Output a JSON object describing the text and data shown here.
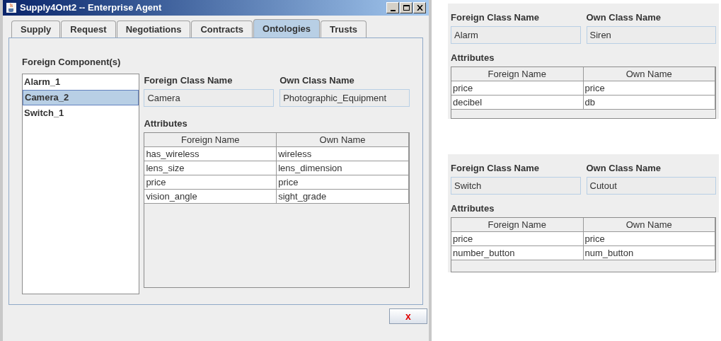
{
  "window": {
    "title": "Supply4Ont2 -- Enterprise Agent"
  },
  "tabs": [
    {
      "label": "Supply",
      "selected": false
    },
    {
      "label": "Request",
      "selected": false
    },
    {
      "label": "Negotiations",
      "selected": false
    },
    {
      "label": "Contracts",
      "selected": false
    },
    {
      "label": "Ontologies",
      "selected": true
    },
    {
      "label": "Trusts",
      "selected": false
    }
  ],
  "components_label": "Foreign Component(s)",
  "components": [
    {
      "label": "Alarm_1",
      "selected": false
    },
    {
      "label": "Camera_2",
      "selected": true
    },
    {
      "label": "Switch_1",
      "selected": false
    }
  ],
  "detail": {
    "foreign_class_label": "Foreign Class Name",
    "own_class_label": "Own Class Name",
    "foreign_class": "Camera",
    "own_class": "Photographic_Equipment",
    "attributes_label": "Attributes",
    "columns": [
      "Foreign Name",
      "Own Name"
    ],
    "rows": [
      [
        "has_wireless",
        "wireless"
      ],
      [
        "lens_size",
        "lens_dimension"
      ],
      [
        "price",
        "price"
      ],
      [
        "vision_angle",
        "sight_grade"
      ]
    ]
  },
  "close_button": "x",
  "extra_panels": [
    {
      "foreign_class_label": "Foreign Class Name",
      "own_class_label": "Own Class Name",
      "foreign_class": "Alarm",
      "own_class": "Siren",
      "attributes_label": "Attributes",
      "columns": [
        "Foreign Name",
        "Own Name"
      ],
      "rows": [
        [
          "price",
          "price"
        ],
        [
          "decibel",
          "db"
        ]
      ]
    },
    {
      "foreign_class_label": "Foreign Class Name",
      "own_class_label": "Own Class Name",
      "foreign_class": "Switch",
      "own_class": "Cutout",
      "attributes_label": "Attributes",
      "columns": [
        "Foreign Name",
        "Own Name"
      ],
      "rows": [
        [
          "price",
          "price"
        ],
        [
          "number_button",
          "num_button"
        ]
      ]
    }
  ]
}
